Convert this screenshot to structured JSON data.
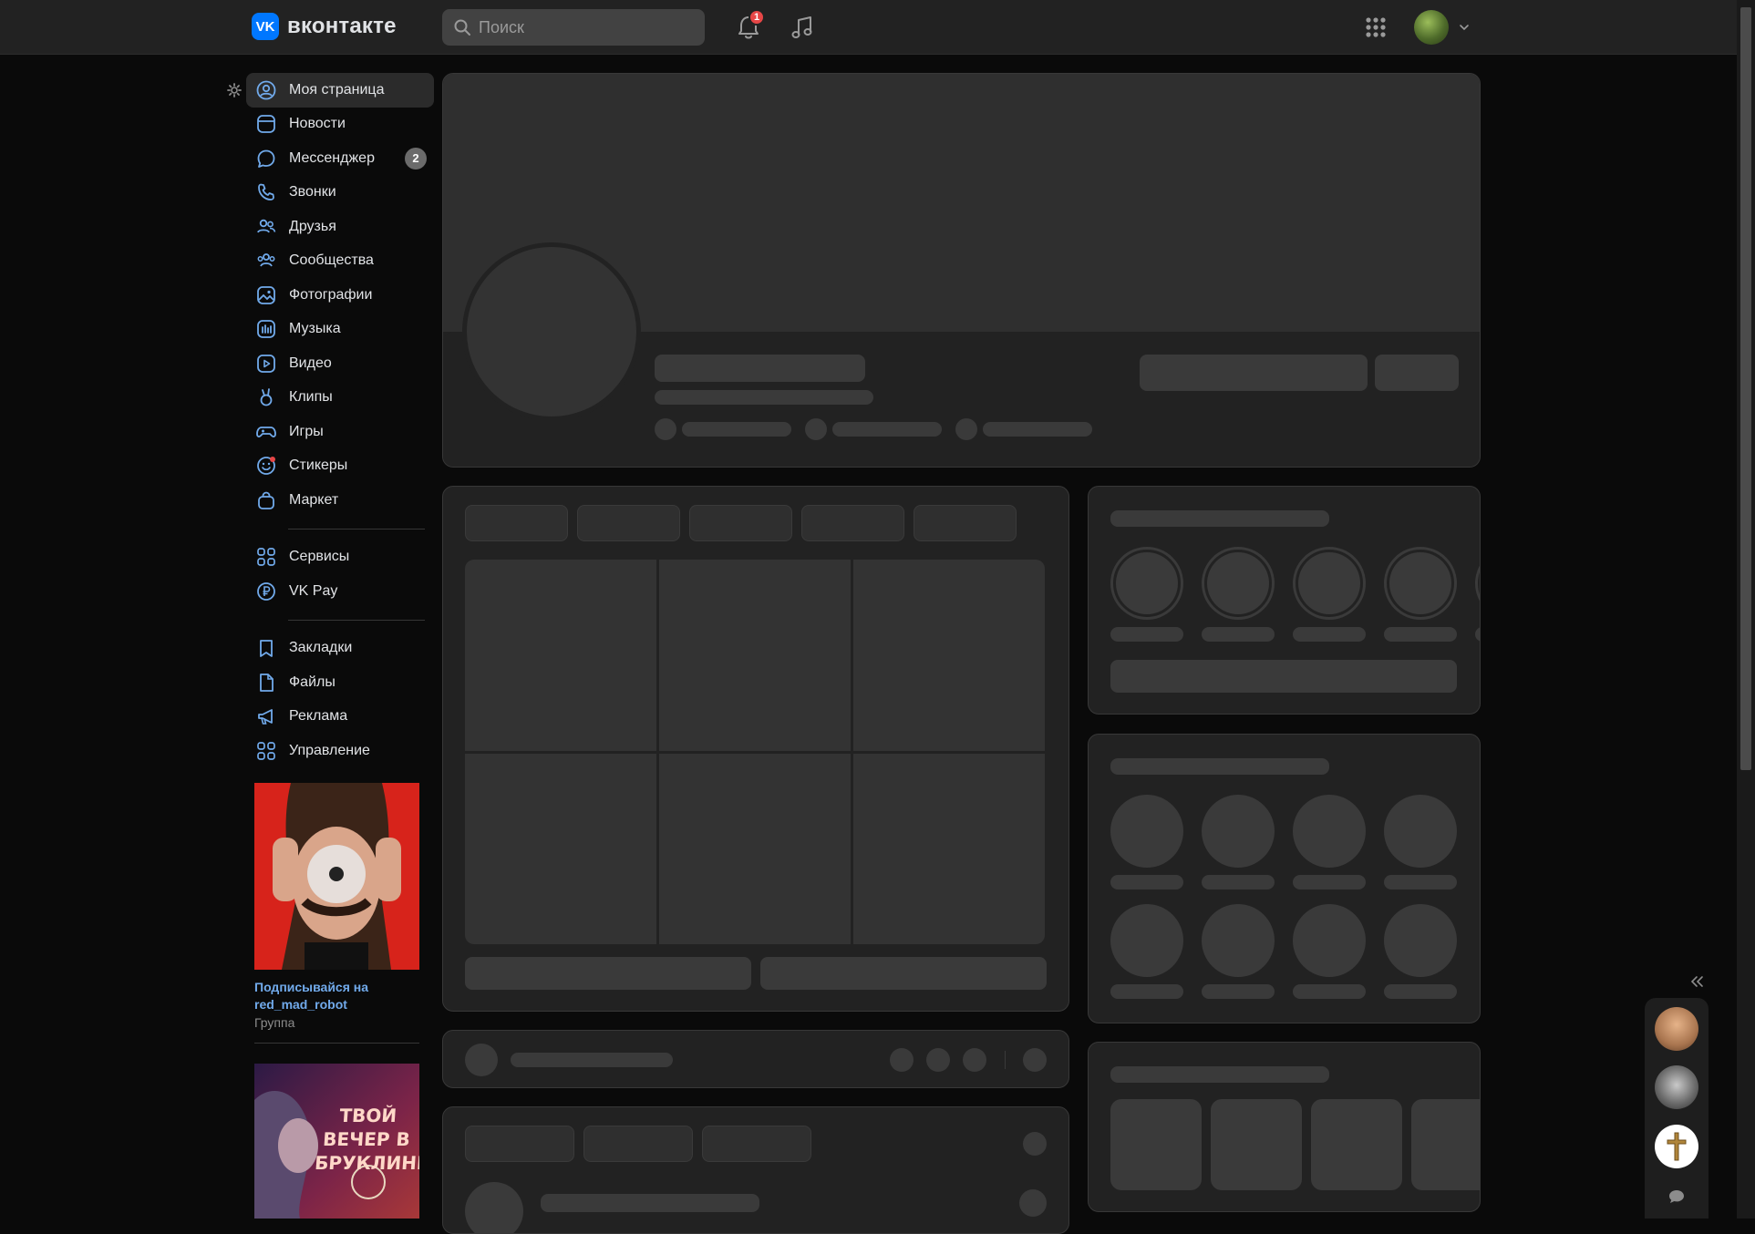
{
  "header": {
    "logo_text": "вконтакте",
    "logo_mark": "VK",
    "search_placeholder": "Поиск",
    "notifications_count": "1"
  },
  "sidebar": {
    "items": [
      {
        "label": "Моя страница",
        "icon": "user-circle-icon"
      },
      {
        "label": "Новости",
        "icon": "newsfeed-icon"
      },
      {
        "label": "Мессенджер",
        "icon": "message-icon",
        "badge": "2"
      },
      {
        "label": "Звонки",
        "icon": "phone-icon"
      },
      {
        "label": "Друзья",
        "icon": "friends-icon"
      },
      {
        "label": "Сообщества",
        "icon": "communities-icon"
      },
      {
        "label": "Фотографии",
        "icon": "photo-icon"
      },
      {
        "label": "Музыка",
        "icon": "music-icon"
      },
      {
        "label": "Видео",
        "icon": "video-icon"
      },
      {
        "label": "Клипы",
        "icon": "clips-icon"
      },
      {
        "label": "Игры",
        "icon": "gamepad-icon"
      },
      {
        "label": "Стикеры",
        "icon": "sticker-icon"
      },
      {
        "label": "Маркет",
        "icon": "market-bag-icon"
      }
    ],
    "items2": [
      {
        "label": "Сервисы",
        "icon": "services-grid-icon"
      },
      {
        "label": "VK Pay",
        "icon": "vkpay-icon"
      }
    ],
    "items3": [
      {
        "label": "Закладки",
        "icon": "bookmark-icon"
      },
      {
        "label": "Файлы",
        "icon": "file-icon"
      },
      {
        "label": "Реклама",
        "icon": "megaphone-icon"
      },
      {
        "label": "Управление",
        "icon": "manage-grid-icon"
      }
    ]
  },
  "promo": {
    "link_text": "Подписывайся на red_mad_robot",
    "type_text": "Группа",
    "second_ad_text": "ТВОЙ ВЕЧЕР В БРУКЛИНЕ"
  },
  "colors": {
    "accent": "#71aaeb",
    "brand": "#0077ff",
    "badge_red": "#e64646",
    "background": "#0a0a0a",
    "card": "#222222"
  }
}
